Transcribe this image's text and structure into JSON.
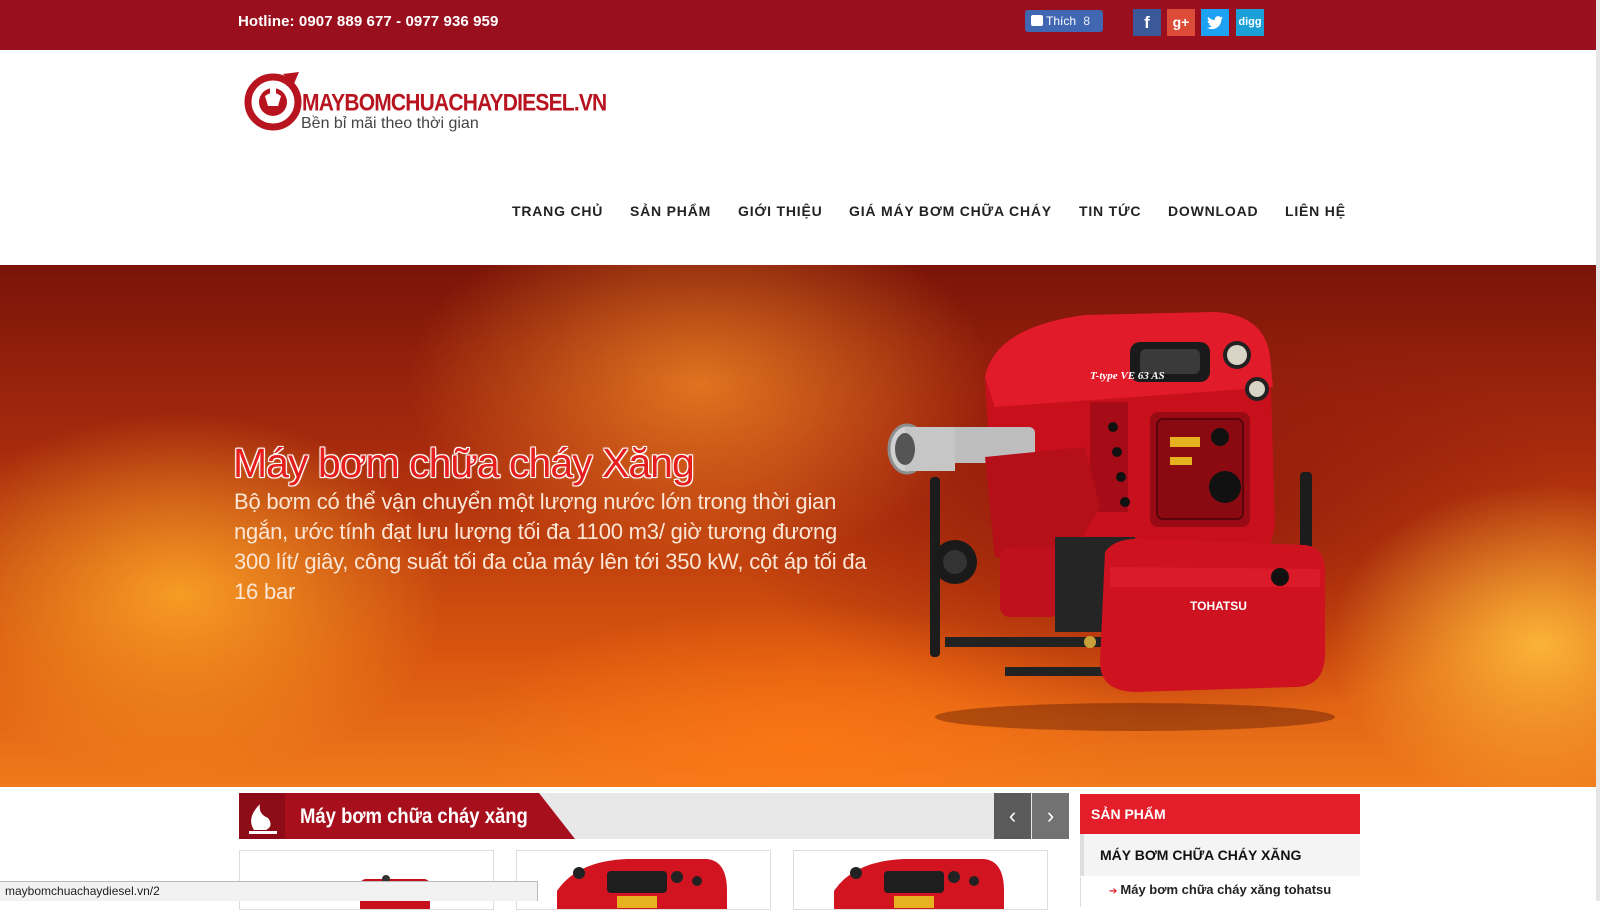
{
  "topbar": {
    "hotline": "Hotline: 0907 889 677  -  0977 936 959",
    "fb_like_label": "Thích",
    "fb_like_count": "8",
    "social": {
      "facebook": "f",
      "google_plus": "g+",
      "twitter": "t",
      "digg": "digg"
    },
    "bg_color": "#9a0f1e"
  },
  "logo": {
    "name": "MAYBOMCHUACHAYDIESEL.VN",
    "tagline": "Bền bỉ mãi theo thời gian"
  },
  "nav": {
    "items": [
      "TRANG CHỦ",
      "SẢN PHẨM",
      "GIỚI THIỆU",
      "GIÁ MÁY BƠM CHỮA CHÁY",
      "TIN TỨC",
      "DOWNLOAD",
      "LIÊN HỆ"
    ]
  },
  "hero": {
    "title": "Máy bơm chữa cháy Xăng",
    "description": "Bộ bơm có thể vận chuyển một lượng nước lớn trong thời gian ngắn, ước tính đạt lưu lượng tối đa 1100 m3/ giờ tương đương 300 lít/ giây, công suất tối đa của máy lên tới 350 kW, cột áp tối đa 16 bar",
    "pump_brand": "TOHATSU",
    "pump_label": "T-type VE 63 AS"
  },
  "section": {
    "title": "Máy bơm chữa cháy xăng",
    "prev": "‹",
    "next": "›"
  },
  "sidebar": {
    "heading": "SẢN PHẨM",
    "category": "MÁY BƠM CHỮA CHÁY XĂNG",
    "sub_item": "Máy bơm chữa cháy xăng tohatsu",
    "accent_color": "#e31e2a"
  },
  "status_bar": {
    "url": "maybomchuachaydiesel.vn/2"
  }
}
